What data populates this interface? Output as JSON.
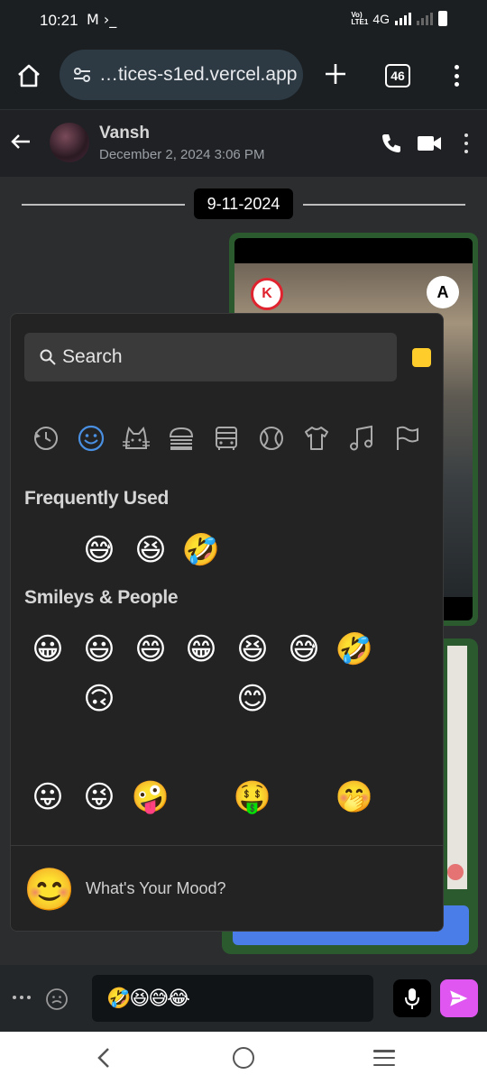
{
  "status_bar": {
    "time": "10:21",
    "notification_icons": "M ›_",
    "volte": "Vo) LTE1",
    "network": "4G"
  },
  "browser": {
    "url": "…tices-s1ed.vercel.app",
    "tab_count": "46"
  },
  "chat_header": {
    "contact_name": "Vansh",
    "last_seen": "December 2, 2024 3:06 PM"
  },
  "chat": {
    "date_separator": "9-11-2024",
    "image_app_left": "K",
    "image_app_right": "A"
  },
  "emoji_picker": {
    "search_placeholder": "Search",
    "skin_tone_color": "#ffcd2b",
    "categories": [
      "recent",
      "smileys",
      "animals",
      "food",
      "travel",
      "activities",
      "objects",
      "symbols",
      "flags"
    ],
    "active_category": "smileys",
    "frequently_used_title": "Frequently Used",
    "frequently_used": [
      "😅",
      "😆",
      "🤣"
    ],
    "smileys_title": "Smileys & People",
    "smileys_row1": [
      "😀",
      "😃",
      "😄",
      "😁",
      "😆",
      "😅",
      "🤣"
    ],
    "smileys_row2": [
      "🙃",
      "😊"
    ],
    "smileys_row4": [
      "😛",
      "😜",
      "🤪",
      "🤑",
      "🤭"
    ],
    "mood_emoji": "😊",
    "mood_prompt": "What's Your Mood?"
  },
  "composer": {
    "message_text": "🤣😆😅😂"
  },
  "colors": {
    "accent_send": "#e056f0",
    "active_category": "#4a90e2",
    "bubble_border": "#2c5a2f"
  }
}
